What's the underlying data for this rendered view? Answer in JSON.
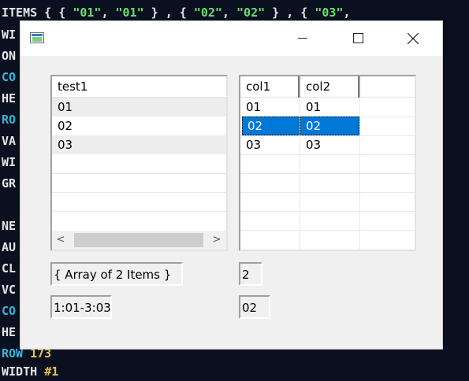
{
  "editor": {
    "line0": {
      "kw": "ITEMS",
      "rest1": " { { ",
      "s1": "\"01\"",
      ",1": ", ",
      "s2": "\"01\"",
      "mid": " } , { ",
      "s3": "\"02\"",
      ",2": ", ",
      "s4": "\"02\"",
      "mid2": " } , { ",
      "s5": "\"03\"",
      "end": ","
    },
    "left_labels": [
      "WI",
      "ON",
      "CO",
      "HE",
      "RO",
      "VA",
      "WI",
      "GR",
      "",
      "NE",
      "AU",
      "CL",
      "VC",
      "CO",
      "HE"
    ],
    "row_line": {
      "kw": "ROW",
      "num": "173"
    },
    "last_line": {
      "kw": "WIDTH",
      "num": "#1"
    }
  },
  "window": {
    "icon": "app-window-icon",
    "buttons": {
      "minimize": "minimize-icon",
      "maximize": "maximize-icon",
      "close": "close-icon"
    }
  },
  "list1": {
    "header": "test1",
    "rows": [
      "01",
      "02",
      "03"
    ],
    "scroll_left": "<",
    "scroll_right": ">"
  },
  "list2": {
    "headers": [
      "col1",
      "col2"
    ],
    "rows": [
      [
        "01",
        "01"
      ],
      [
        "02",
        "02"
      ],
      [
        "03",
        "03"
      ]
    ],
    "selected_row": 1
  },
  "fields": {
    "array_text": "{ Array of 2 Items }",
    "count_text": "2",
    "range_text": "1:01-3:03",
    "value_text": "02"
  },
  "colors": {
    "selection": "#0078d7",
    "editor_bg": "#0b1020"
  }
}
